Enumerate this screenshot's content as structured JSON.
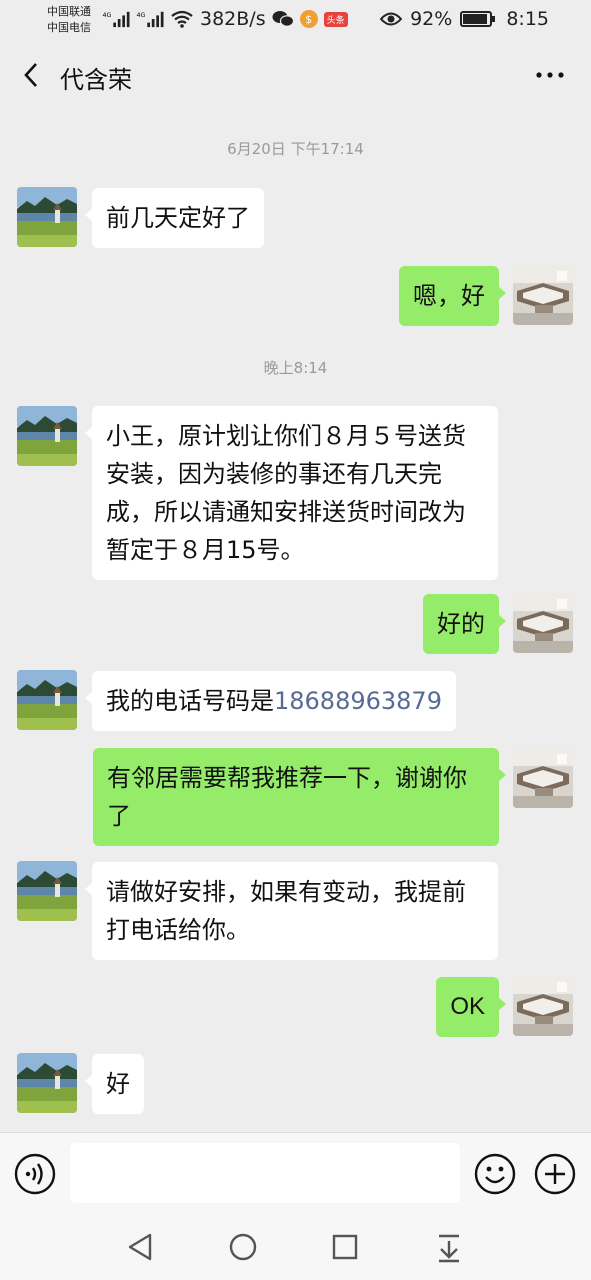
{
  "status_bar": {
    "carrier1": "中国联通",
    "carrier2": "中国电信",
    "net1": "4G",
    "net2": "4G",
    "speed": "382B/s",
    "badge_app": "头条",
    "badge_orange": "$",
    "battery": "92%",
    "battery_level": 0.92,
    "time": "8:15"
  },
  "header": {
    "title": "代含荣"
  },
  "chat": {
    "ts1": "6月20日 下午17:14",
    "ts2": "晚上8:14",
    "m1": "前几天定好了",
    "m2": "嗯，好",
    "m3": "小王，原计划让你们８月５号送货安装，因为装修的事还有几天完成，所以请通知安排送货时间改为暂定于８月15号。",
    "m4": "好的",
    "m5_prefix": "我的电话号码是",
    "m5_phone": "18688963879",
    "m6": "有邻居需要帮我推荐一下，谢谢你了",
    "m7": "请做好安排，如果有变动，我提前打电话给你。",
    "m8": "OK",
    "m9": "好"
  },
  "icons": {
    "back": "back-arrow-icon",
    "more": "more-icon",
    "voice": "voice-icon",
    "emoji": "emoji-icon",
    "plus": "plus-icon"
  },
  "colors": {
    "outgoing": "#95ec69",
    "incoming": "#ffffff",
    "background": "#ededed",
    "link": "#576b95"
  }
}
